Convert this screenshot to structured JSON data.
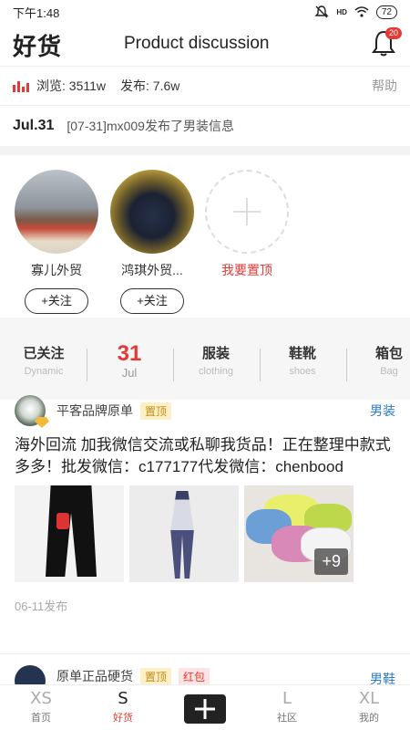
{
  "status_bar": {
    "time": "下午1:48",
    "battery": "72",
    "signal_label": "HD"
  },
  "header": {
    "logo": "好货",
    "title": "Product discussion",
    "bell_badge": "20"
  },
  "stats": {
    "views": "浏览: 3511w",
    "posts": "发布: 7.6w",
    "help": "帮助"
  },
  "notice": {
    "date": "Jul.31",
    "text": "[07-31]mx009发布了男装信息"
  },
  "pinned": {
    "items": [
      {
        "name": "寡儿外贸",
        "follow": "+关注"
      },
      {
        "name": "鸿琪外贸...",
        "follow": "+关注"
      }
    ],
    "add_label": "我要置顶"
  },
  "categories": {
    "followed": {
      "cn": "已关注",
      "en": "Dynamic"
    },
    "date": {
      "day": "31",
      "month": "Jul"
    },
    "clothing": {
      "cn": "服装",
      "en": "clothing"
    },
    "shoes": {
      "cn": "鞋靴",
      "en": "shoes"
    },
    "bag": {
      "cn": "箱包",
      "en": "Bag"
    }
  },
  "post": {
    "author": "平客品牌原单",
    "tag_top": "置顶",
    "category": "男装",
    "body": "海外回流 加我微信交流或私聊我货品！正在整理中款式多多！批发微信：c177177代发微信：chenbood",
    "more_images": "+9",
    "time": "06-11发布"
  },
  "post2": {
    "author": "原单正品硬货",
    "tag_top": "置顶",
    "tag_red": "红包",
    "category": "男鞋"
  },
  "nav": [
    {
      "big": "XS",
      "small": "首页"
    },
    {
      "big": "S",
      "small": "好货"
    },
    {
      "big": "",
      "small": ""
    },
    {
      "big": "L",
      "small": "社区"
    },
    {
      "big": "XL",
      "small": "我的"
    }
  ],
  "colors": {
    "accent": "#e53935",
    "link_blue": "#2b7bc8",
    "tag_gold": "#c28b18"
  }
}
